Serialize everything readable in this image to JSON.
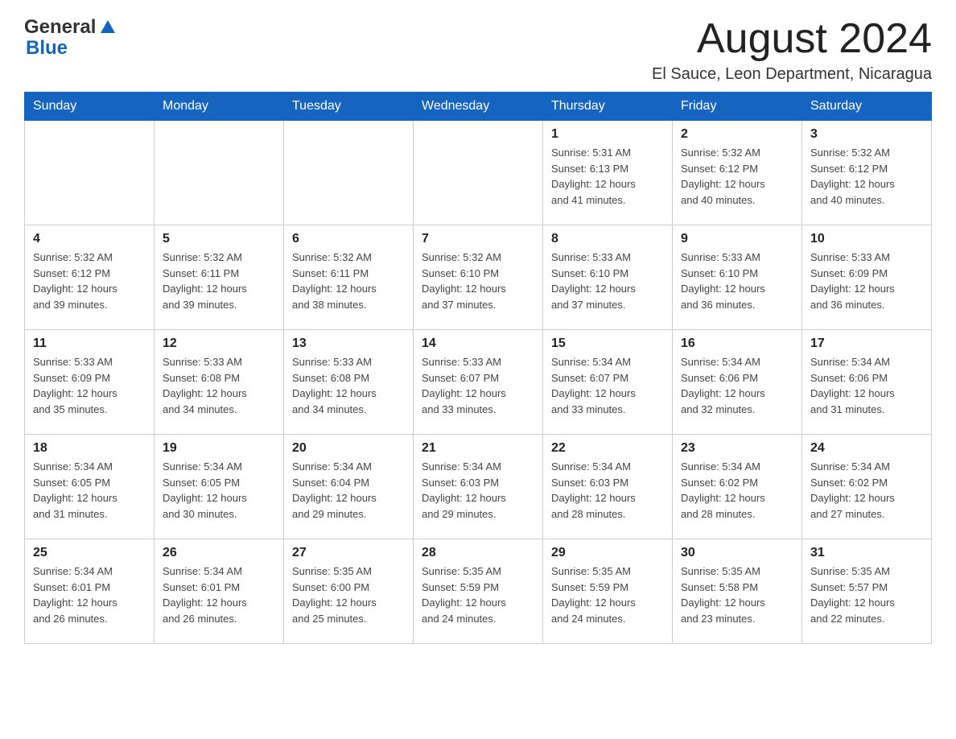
{
  "header": {
    "logo_general": "General",
    "logo_blue": "Blue",
    "month_title": "August 2024",
    "location": "El Sauce, Leon Department, Nicaragua"
  },
  "days_of_week": [
    "Sunday",
    "Monday",
    "Tuesday",
    "Wednesday",
    "Thursday",
    "Friday",
    "Saturday"
  ],
  "weeks": [
    {
      "days": [
        {
          "number": "",
          "info": ""
        },
        {
          "number": "",
          "info": ""
        },
        {
          "number": "",
          "info": ""
        },
        {
          "number": "",
          "info": ""
        },
        {
          "number": "1",
          "info": "Sunrise: 5:31 AM\nSunset: 6:13 PM\nDaylight: 12 hours\nand 41 minutes."
        },
        {
          "number": "2",
          "info": "Sunrise: 5:32 AM\nSunset: 6:12 PM\nDaylight: 12 hours\nand 40 minutes."
        },
        {
          "number": "3",
          "info": "Sunrise: 5:32 AM\nSunset: 6:12 PM\nDaylight: 12 hours\nand 40 minutes."
        }
      ]
    },
    {
      "days": [
        {
          "number": "4",
          "info": "Sunrise: 5:32 AM\nSunset: 6:12 PM\nDaylight: 12 hours\nand 39 minutes."
        },
        {
          "number": "5",
          "info": "Sunrise: 5:32 AM\nSunset: 6:11 PM\nDaylight: 12 hours\nand 39 minutes."
        },
        {
          "number": "6",
          "info": "Sunrise: 5:32 AM\nSunset: 6:11 PM\nDaylight: 12 hours\nand 38 minutes."
        },
        {
          "number": "7",
          "info": "Sunrise: 5:32 AM\nSunset: 6:10 PM\nDaylight: 12 hours\nand 37 minutes."
        },
        {
          "number": "8",
          "info": "Sunrise: 5:33 AM\nSunset: 6:10 PM\nDaylight: 12 hours\nand 37 minutes."
        },
        {
          "number": "9",
          "info": "Sunrise: 5:33 AM\nSunset: 6:10 PM\nDaylight: 12 hours\nand 36 minutes."
        },
        {
          "number": "10",
          "info": "Sunrise: 5:33 AM\nSunset: 6:09 PM\nDaylight: 12 hours\nand 36 minutes."
        }
      ]
    },
    {
      "days": [
        {
          "number": "11",
          "info": "Sunrise: 5:33 AM\nSunset: 6:09 PM\nDaylight: 12 hours\nand 35 minutes."
        },
        {
          "number": "12",
          "info": "Sunrise: 5:33 AM\nSunset: 6:08 PM\nDaylight: 12 hours\nand 34 minutes."
        },
        {
          "number": "13",
          "info": "Sunrise: 5:33 AM\nSunset: 6:08 PM\nDaylight: 12 hours\nand 34 minutes."
        },
        {
          "number": "14",
          "info": "Sunrise: 5:33 AM\nSunset: 6:07 PM\nDaylight: 12 hours\nand 33 minutes."
        },
        {
          "number": "15",
          "info": "Sunrise: 5:34 AM\nSunset: 6:07 PM\nDaylight: 12 hours\nand 33 minutes."
        },
        {
          "number": "16",
          "info": "Sunrise: 5:34 AM\nSunset: 6:06 PM\nDaylight: 12 hours\nand 32 minutes."
        },
        {
          "number": "17",
          "info": "Sunrise: 5:34 AM\nSunset: 6:06 PM\nDaylight: 12 hours\nand 31 minutes."
        }
      ]
    },
    {
      "days": [
        {
          "number": "18",
          "info": "Sunrise: 5:34 AM\nSunset: 6:05 PM\nDaylight: 12 hours\nand 31 minutes."
        },
        {
          "number": "19",
          "info": "Sunrise: 5:34 AM\nSunset: 6:05 PM\nDaylight: 12 hours\nand 30 minutes."
        },
        {
          "number": "20",
          "info": "Sunrise: 5:34 AM\nSunset: 6:04 PM\nDaylight: 12 hours\nand 29 minutes."
        },
        {
          "number": "21",
          "info": "Sunrise: 5:34 AM\nSunset: 6:03 PM\nDaylight: 12 hours\nand 29 minutes."
        },
        {
          "number": "22",
          "info": "Sunrise: 5:34 AM\nSunset: 6:03 PM\nDaylight: 12 hours\nand 28 minutes."
        },
        {
          "number": "23",
          "info": "Sunrise: 5:34 AM\nSunset: 6:02 PM\nDaylight: 12 hours\nand 28 minutes."
        },
        {
          "number": "24",
          "info": "Sunrise: 5:34 AM\nSunset: 6:02 PM\nDaylight: 12 hours\nand 27 minutes."
        }
      ]
    },
    {
      "days": [
        {
          "number": "25",
          "info": "Sunrise: 5:34 AM\nSunset: 6:01 PM\nDaylight: 12 hours\nand 26 minutes."
        },
        {
          "number": "26",
          "info": "Sunrise: 5:34 AM\nSunset: 6:01 PM\nDaylight: 12 hours\nand 26 minutes."
        },
        {
          "number": "27",
          "info": "Sunrise: 5:35 AM\nSunset: 6:00 PM\nDaylight: 12 hours\nand 25 minutes."
        },
        {
          "number": "28",
          "info": "Sunrise: 5:35 AM\nSunset: 5:59 PM\nDaylight: 12 hours\nand 24 minutes."
        },
        {
          "number": "29",
          "info": "Sunrise: 5:35 AM\nSunset: 5:59 PM\nDaylight: 12 hours\nand 24 minutes."
        },
        {
          "number": "30",
          "info": "Sunrise: 5:35 AM\nSunset: 5:58 PM\nDaylight: 12 hours\nand 23 minutes."
        },
        {
          "number": "31",
          "info": "Sunrise: 5:35 AM\nSunset: 5:57 PM\nDaylight: 12 hours\nand 22 minutes."
        }
      ]
    }
  ]
}
